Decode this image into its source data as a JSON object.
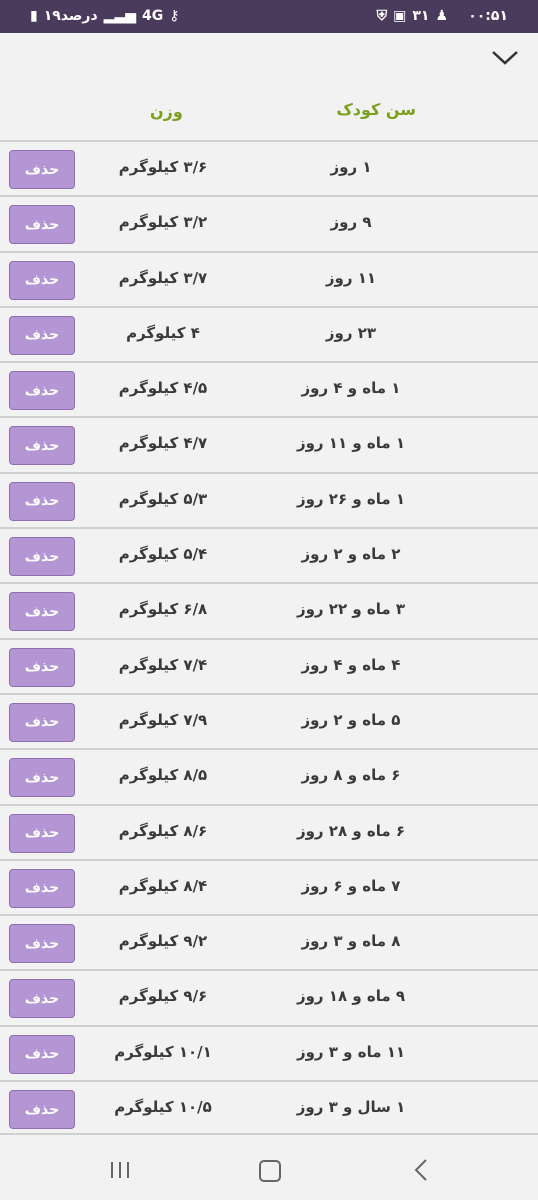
{
  "status_bar": {
    "time": "۰۰:۵۱",
    "date_num": "۳۱",
    "battery": "۱۹درصد",
    "network": "4G"
  },
  "header": {
    "age_label": "سن کودک",
    "weight_label": "وزن"
  },
  "rows": [
    {
      "age": "۱ روز",
      "weight": "۳/۶ کیلوگرم",
      "action": "حذف"
    },
    {
      "age": "۹ روز",
      "weight": "۳/۲ کیلوگرم",
      "action": "حذف"
    },
    {
      "age": "۱۱ روز",
      "weight": "۳/۷ کیلوگرم",
      "action": "حذف"
    },
    {
      "age": "۲۳ روز",
      "weight": "۴ کیلوگرم",
      "action": "حذف"
    },
    {
      "age": "۱ ماه و ۴ روز",
      "weight": "۴/۵ کیلوگرم",
      "action": "حذف"
    },
    {
      "age": "۱ ماه و ۱۱ روز",
      "weight": "۴/۷ کیلوگرم",
      "action": "حذف"
    },
    {
      "age": "۱ ماه و ۲۶ روز",
      "weight": "۵/۳ کیلوگرم",
      "action": "حذف"
    },
    {
      "age": "۲ ماه و ۲ روز",
      "weight": "۵/۴ کیلوگرم",
      "action": "حذف"
    },
    {
      "age": "۳ ماه و ۲۲ روز",
      "weight": "۶/۸ کیلوگرم",
      "action": "حذف"
    },
    {
      "age": "۴ ماه و ۴ روز",
      "weight": "۷/۴ کیلوگرم",
      "action": "حذف"
    },
    {
      "age": "۵ ماه و ۲ روز",
      "weight": "۷/۹ کیلوگرم",
      "action": "حذف"
    },
    {
      "age": "۶ ماه و ۸ روز",
      "weight": "۸/۵ کیلوگرم",
      "action": "حذف"
    },
    {
      "age": "۶ ماه و ۲۸ روز",
      "weight": "۸/۶ کیلوگرم",
      "action": "حذف"
    },
    {
      "age": "۷ ماه و ۶ روز",
      "weight": "۸/۴ کیلوگرم",
      "action": "حذف"
    },
    {
      "age": "۸ ماه و ۳ روز",
      "weight": "۹/۲ کیلوگرم",
      "action": "حذف"
    },
    {
      "age": "۹ ماه و ۱۸ روز",
      "weight": "۹/۶ کیلوگرم",
      "action": "حذف"
    },
    {
      "age": "۱۱ ماه و ۳ روز",
      "weight": "۱۰/۱ کیلوگرم",
      "action": "حذف"
    },
    {
      "age": "۱ سال و ۳ روز",
      "weight": "۱۰/۵ کیلوگرم",
      "action": "حذف"
    }
  ],
  "colors": {
    "status_bar": "#4a3b5c",
    "header_text": "#7ba11e",
    "delete_button": "#b596d4"
  }
}
